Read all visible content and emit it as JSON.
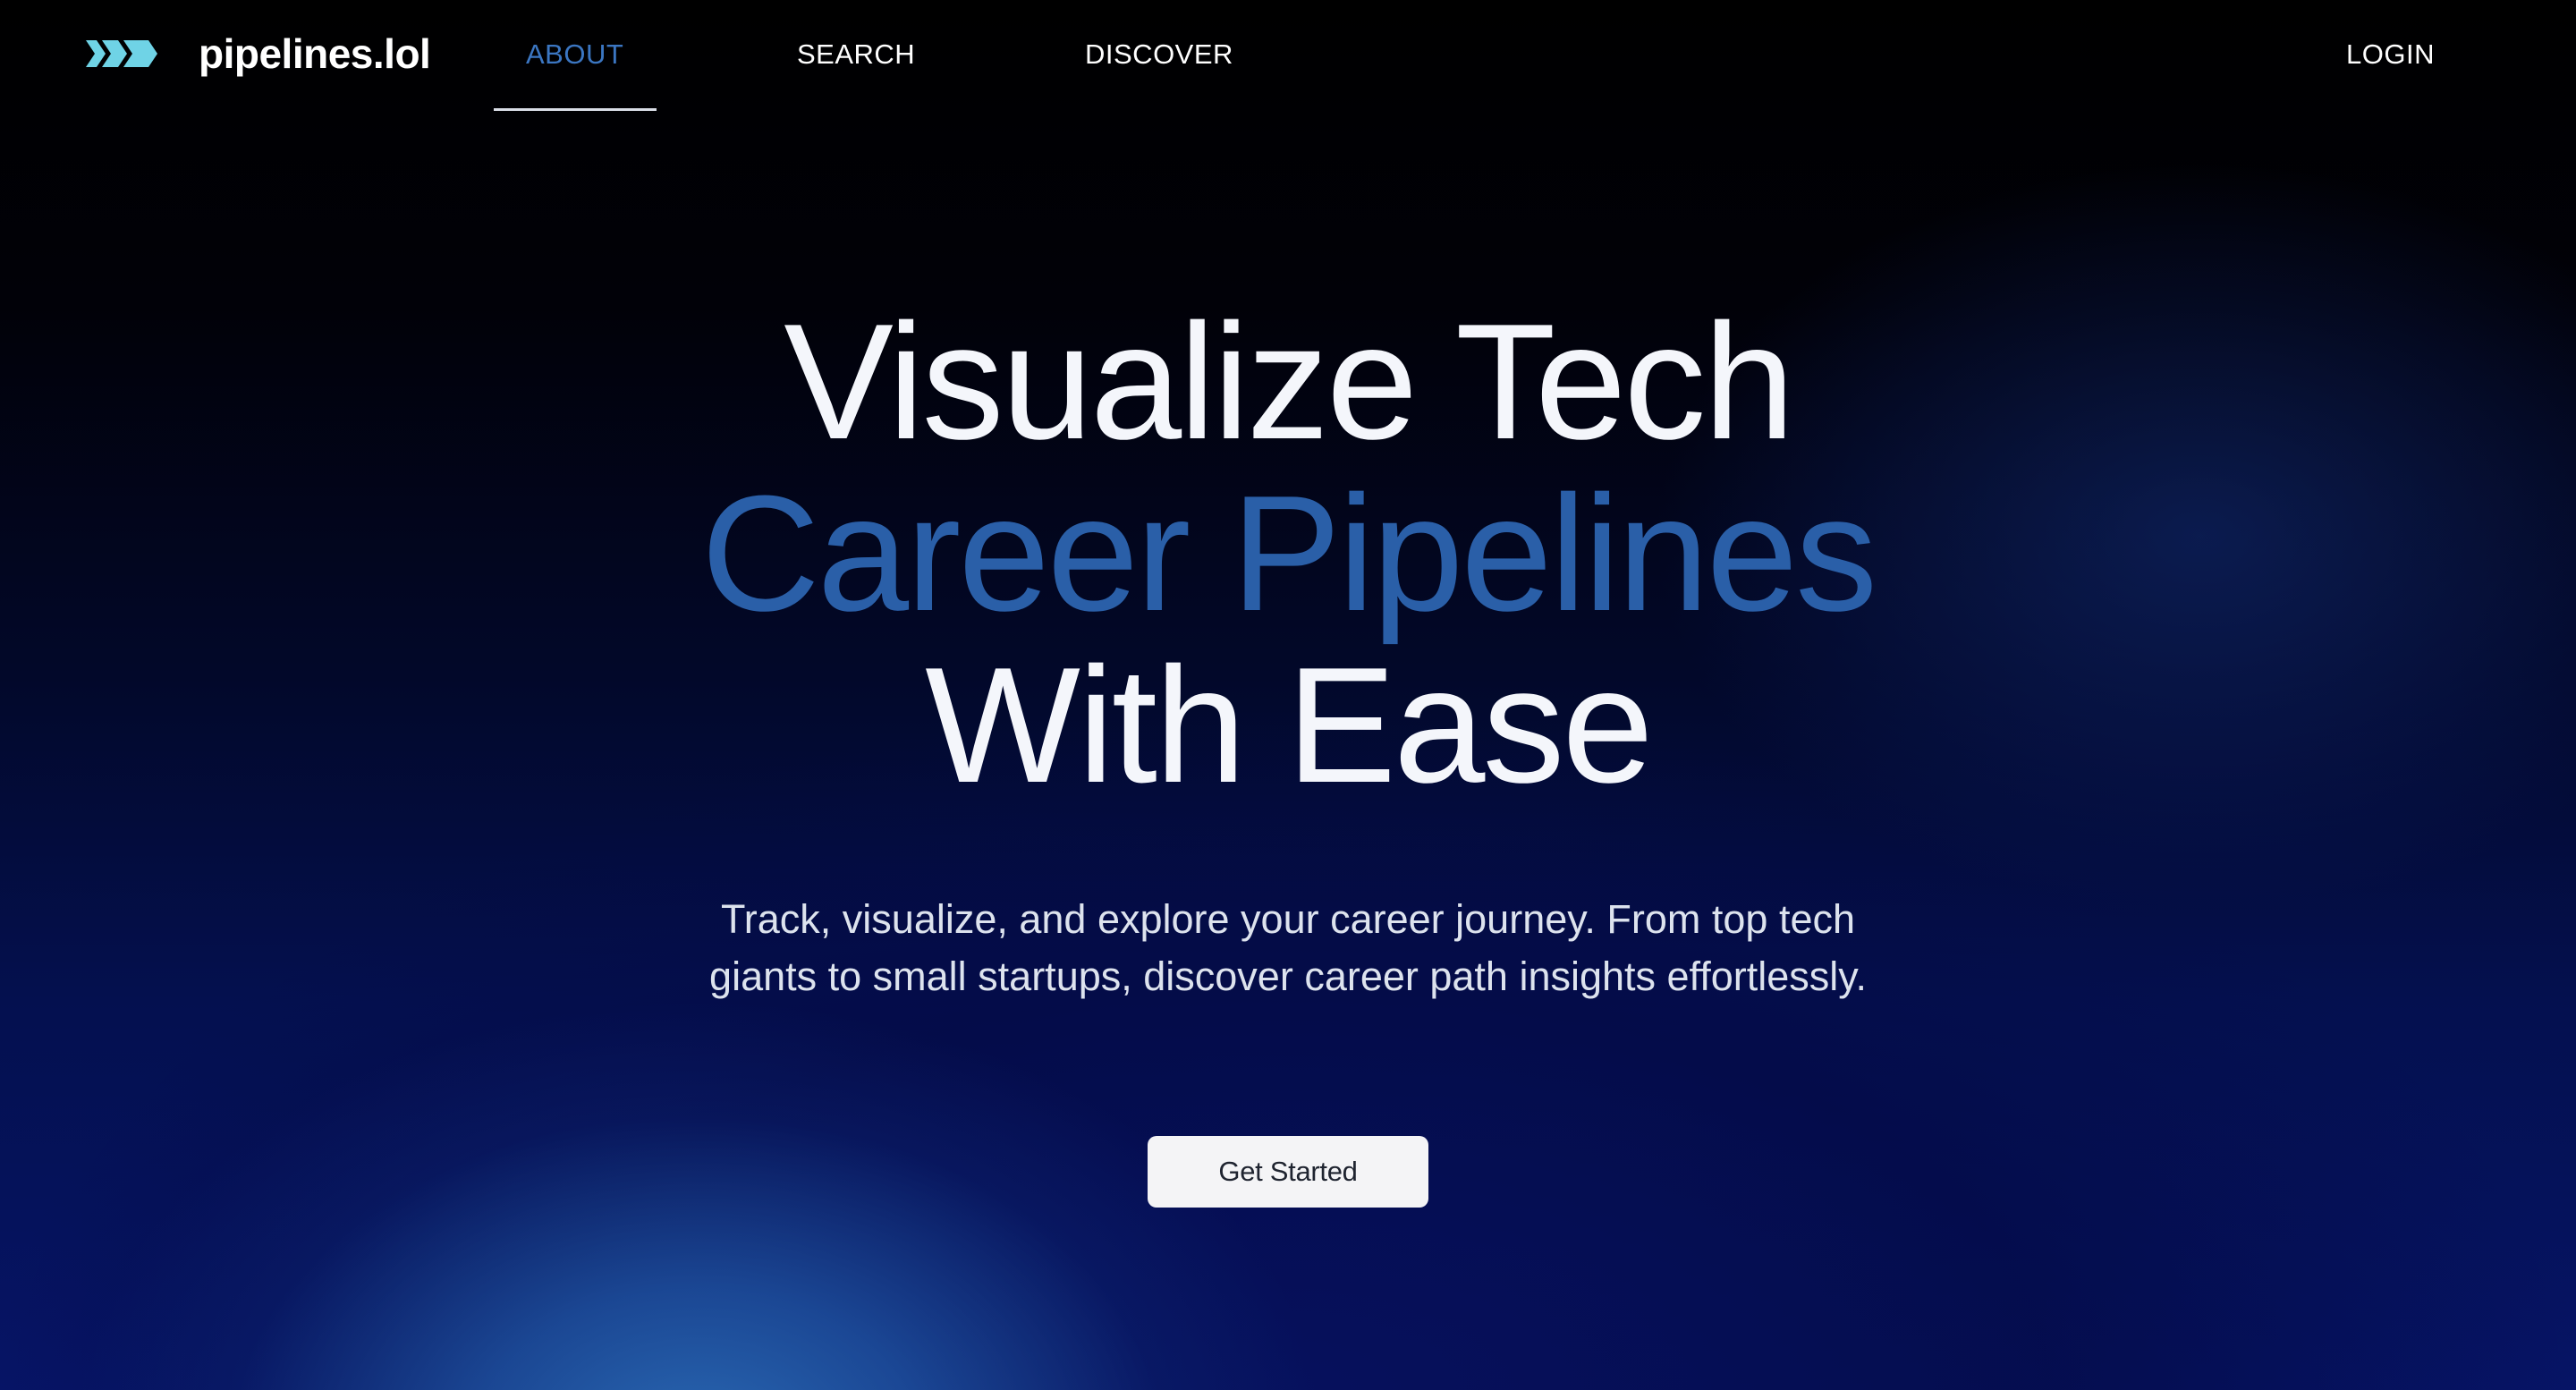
{
  "brand": {
    "name": "pipelines.lol",
    "icon": "triple-chevron-logo-icon",
    "icon_color": "#6fd3e6"
  },
  "nav": {
    "items": [
      {
        "label": "ABOUT",
        "active": true
      },
      {
        "label": "SEARCH",
        "active": false
      },
      {
        "label": "DISCOVER",
        "active": false
      }
    ],
    "login_label": "LOGIN",
    "active_color": "#3b76c2"
  },
  "hero": {
    "title_line1": "Visualize Tech",
    "title_line2": "Career Pipelines",
    "title_line3": "With Ease",
    "highlight_color": "#2a5fa8",
    "subtitle_line1": "Track, visualize, and explore your career journey. From top tech",
    "subtitle_line2": "giants to small startups, discover career path insights effortlessly.",
    "cta_label": "Get Started"
  }
}
